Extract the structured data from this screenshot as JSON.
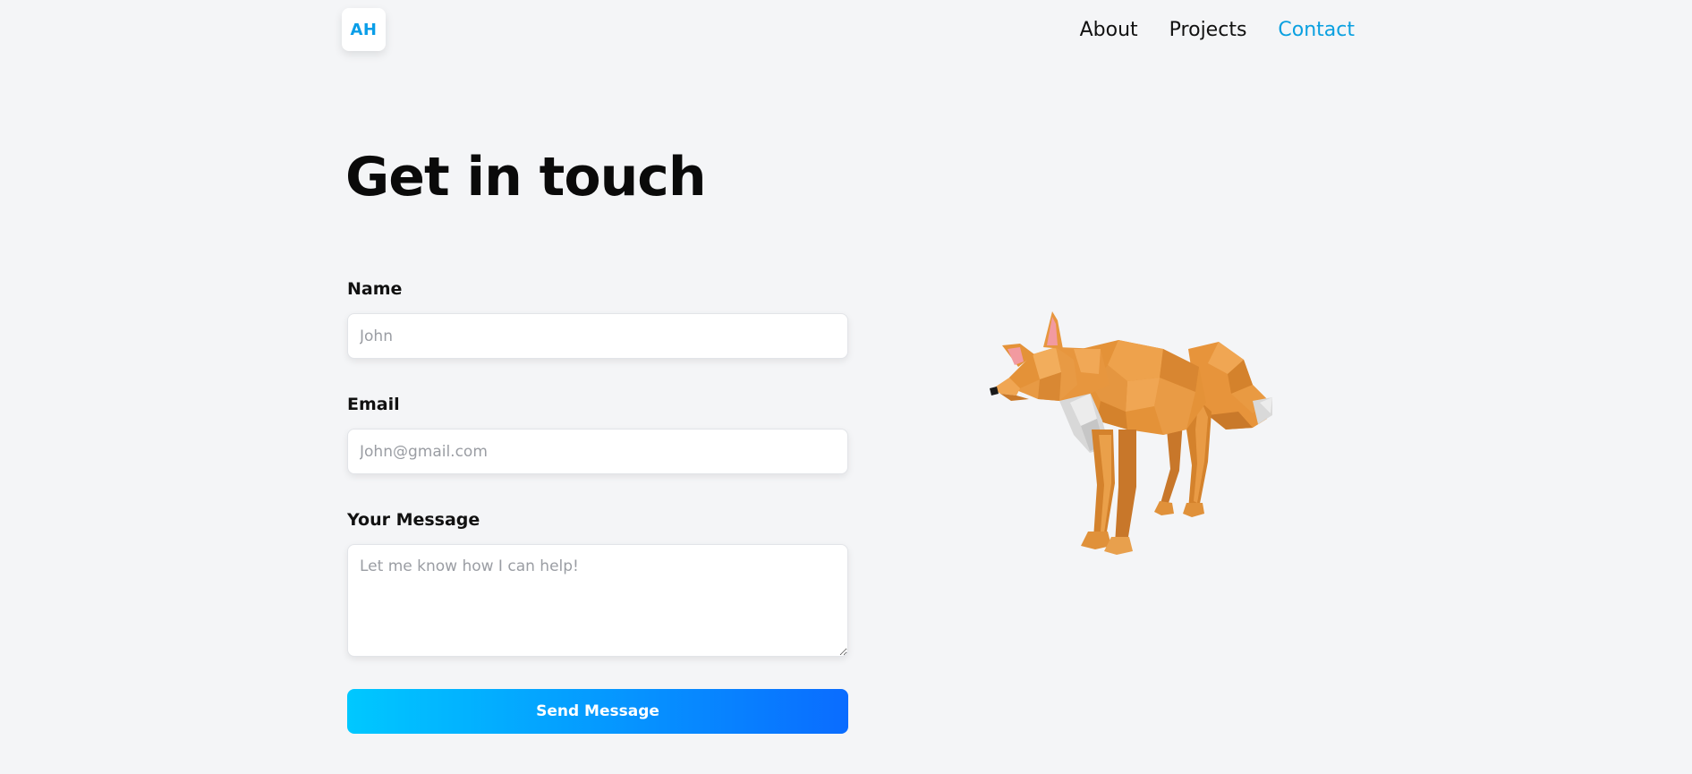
{
  "header": {
    "logo_text": "AH",
    "nav": [
      {
        "label": "About",
        "active": false
      },
      {
        "label": "Projects",
        "active": false
      },
      {
        "label": "Contact",
        "active": true
      }
    ]
  },
  "main": {
    "title": "Get in touch",
    "form": {
      "name": {
        "label": "Name",
        "placeholder": "John",
        "value": ""
      },
      "email": {
        "label": "Email",
        "placeholder": "John@gmail.com",
        "value": ""
      },
      "message": {
        "label": "Your Message",
        "placeholder": "Let me know how I can help!",
        "value": ""
      },
      "submit_label": "Send Message"
    },
    "illustration": {
      "icon": "low-poly-fox"
    }
  },
  "colors": {
    "background": "#f4f5f7",
    "accent": "#0aa0e0",
    "button_gradient_start": "#00c8ff",
    "button_gradient_end": "#0a6cff",
    "fox_orange": "#e0913a"
  }
}
